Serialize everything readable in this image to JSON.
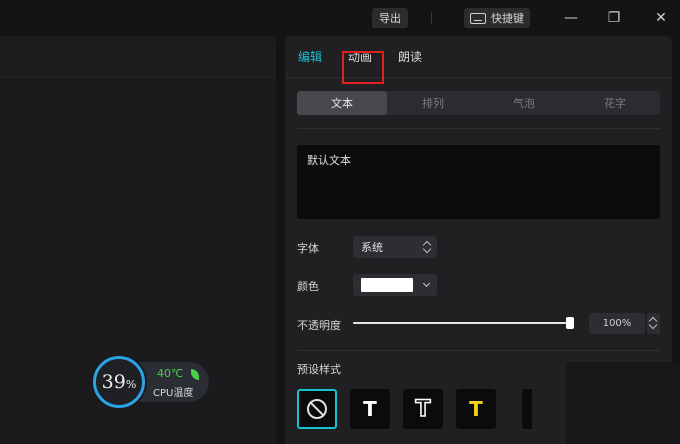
{
  "titlebar": {
    "export_label": "导出",
    "shortcut_label": "快捷键",
    "minimize_glyph": "—",
    "restore_glyph": "❐",
    "close_glyph": "✕"
  },
  "cpu_widget": {
    "percent_value": "39",
    "percent_unit": "%",
    "temperature": "40℃",
    "label": "CPU温度",
    "ring_color": "#2aa4e6",
    "temp_color": "#4ad04a"
  },
  "panel": {
    "tabs": [
      {
        "label": "编辑",
        "active": true
      },
      {
        "label": "动画",
        "active": false
      },
      {
        "label": "朗读",
        "active": false
      }
    ],
    "subtabs": [
      {
        "label": "文本",
        "active": true
      },
      {
        "label": "排列",
        "active": false
      },
      {
        "label": "气泡",
        "active": false
      },
      {
        "label": "花字",
        "active": false
      }
    ],
    "text_value": "默认文本",
    "font_label": "字体",
    "font_value": "系统",
    "color_label": "颜色",
    "color_value": "#ffffff",
    "opacity_label": "不透明度",
    "opacity_value": "100%",
    "opacity_fraction": 1.0,
    "preset_label": "预设样式",
    "presets": [
      {
        "name": "none",
        "icon": "no-style-icon"
      },
      {
        "name": "white",
        "glyph": "T"
      },
      {
        "name": "outline",
        "glyph": "T"
      },
      {
        "name": "yellow",
        "glyph": "T"
      }
    ],
    "accent_color": "#19c1d1",
    "highlight_color": "#e0201e"
  }
}
